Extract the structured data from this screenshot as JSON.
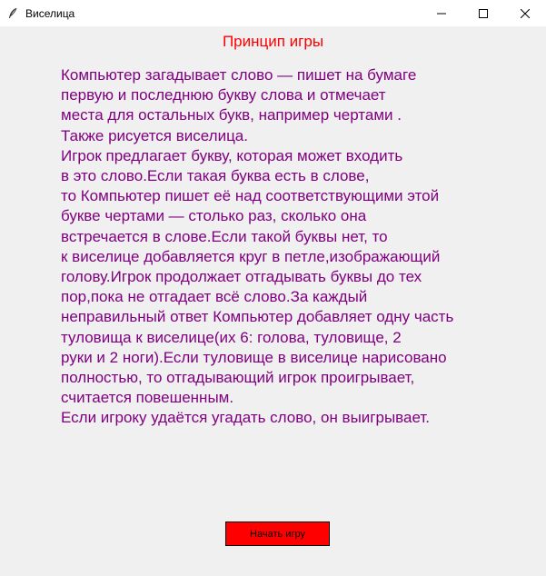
{
  "window": {
    "title": "Виселица",
    "app_icon": "feather-icon",
    "controls": [
      "minimize-icon",
      "maximize-icon",
      "close-icon"
    ]
  },
  "heading": "Принцип игры",
  "rules_lines": [
    "Компьютер загадывает слово — пишет на бумаге",
    "первую и последнюю букву слова и отмечает",
    "места для остальных букв, например чертами .",
    "Также рисуется виселица.",
    "Игрок предлагает букву, которая может входить",
    "в это слово.Если такая буква есть в слове,",
    "то Компьютер пишет её над соответствующими этой",
    "букве чертами — столько раз, сколько она",
    "встречается в слове.Если такой буквы нет, то",
    "к виселице добавляется круг в петле,изображающий",
    "голову.Игрок продолжает отгадывать буквы до тех",
    "пор,пока не отгадает всё слово.За каждый",
    "неправильный ответ Компьютер добавляет одну часть",
    "туловища к виселице(их 6: голова, туловище, 2",
    "руки и 2 ноги).Если туловище в виселице нарисовано",
    "полностью, то отгадывающий игрок проигрывает,",
    "считается повешенным.",
    "Если игроку удаётся угадать слово, он выигрывает."
  ],
  "start_button_label": "Начать игру",
  "colors": {
    "heading": "#ff0000",
    "rules_text": "#800080",
    "button_bg": "#ff0000",
    "window_bg": "#f0f0f0",
    "titlebar_bg": "#ffffff"
  }
}
